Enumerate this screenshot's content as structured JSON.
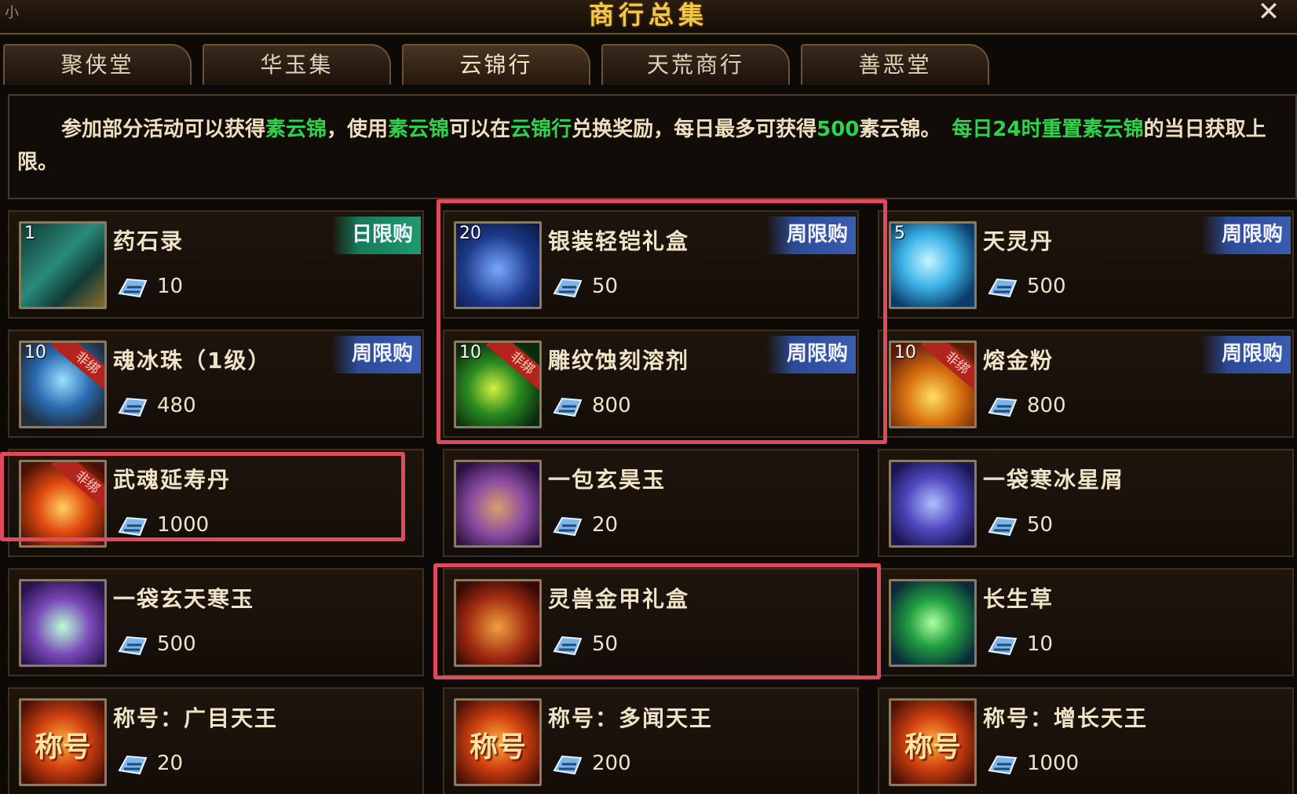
{
  "window": {
    "title": "商行总集",
    "corner_text": "小",
    "close_label": "✕"
  },
  "tabs": [
    {
      "label": "聚侠堂",
      "active": false
    },
    {
      "label": "华玉集",
      "active": false
    },
    {
      "label": "云锦行",
      "active": true
    },
    {
      "label": "天荒商行",
      "active": false
    },
    {
      "label": "善恶堂",
      "active": false
    }
  ],
  "description": {
    "p1": "参加部分活动可以获得",
    "g1": "素云锦",
    "p2": "，使用",
    "g2": "素云锦",
    "p3": "可以在",
    "g3": "云锦行",
    "p4": "兑换奖励，每日最多可获得",
    "g4": "500",
    "p5": "素云锦。",
    "g5": "每日24时重置素云锦",
    "p6": "的当日获取上限。"
  },
  "currency_icon": "cloud-brocade-icon",
  "items": [
    {
      "name": "药石录",
      "price": "10",
      "stack": "1",
      "badge": "日限购",
      "badge_color": "#1f9a6e",
      "ribbon": "",
      "icon": "scroll-icon"
    },
    {
      "name": "银装轻铠礼盒",
      "price": "50",
      "stack": "20",
      "badge": "周限购",
      "badge_color": "#3a5db0",
      "ribbon": "",
      "icon": "silver-chest-icon"
    },
    {
      "name": "天灵丹",
      "price": "500",
      "stack": "5",
      "badge": "周限购",
      "badge_color": "#3a5db0",
      "ribbon": "",
      "icon": "spirit-orb-icon"
    },
    {
      "name": "魂冰珠（1级）",
      "price": "480",
      "stack": "10",
      "badge": "周限购",
      "badge_color": "#3a5db0",
      "ribbon": "非绑",
      "icon": "ice-pearl-icon"
    },
    {
      "name": "雕纹蚀刻溶剂",
      "price": "800",
      "stack": "10",
      "badge": "周限购",
      "badge_color": "#3a5db0",
      "ribbon": "非绑",
      "icon": "green-solvent-icon"
    },
    {
      "name": "熔金粉",
      "price": "800",
      "stack": "10",
      "badge": "周限购",
      "badge_color": "#3a5db0",
      "ribbon": "非绑",
      "icon": "gold-powder-icon"
    },
    {
      "name": "武魂延寿丹",
      "price": "1000",
      "stack": "",
      "badge": "",
      "badge_color": "",
      "ribbon": "非绑",
      "icon": "fire-pill-icon"
    },
    {
      "name": "一包玄昊玉",
      "price": "20",
      "stack": "",
      "badge": "",
      "badge_color": "",
      "ribbon": "",
      "icon": "jade-pouch-icon"
    },
    {
      "name": "一袋寒冰星屑",
      "price": "50",
      "stack": "",
      "badge": "",
      "badge_color": "",
      "ribbon": "",
      "icon": "star-dust-bag-icon"
    },
    {
      "name": "一袋玄天寒玉",
      "price": "500",
      "stack": "",
      "badge": "",
      "badge_color": "",
      "ribbon": "",
      "icon": "cold-jade-bag-icon"
    },
    {
      "name": "灵兽金甲礼盒",
      "price": "50",
      "stack": "",
      "badge": "",
      "badge_color": "",
      "ribbon": "",
      "icon": "red-chest-icon"
    },
    {
      "name": "长生草",
      "price": "10",
      "stack": "",
      "badge": "",
      "badge_color": "",
      "ribbon": "",
      "icon": "herb-icon"
    },
    {
      "name": "称号：广目天王",
      "price": "20",
      "stack": "",
      "badge": "",
      "badge_color": "",
      "ribbon": "",
      "icon": "title-scroll-icon",
      "icon_text": "称号"
    },
    {
      "name": "称号：多闻天王",
      "price": "200",
      "stack": "",
      "badge": "",
      "badge_color": "",
      "ribbon": "",
      "icon": "title-scroll-icon",
      "icon_text": "称号"
    },
    {
      "name": "称号：增长天王",
      "price": "1000",
      "stack": "",
      "badge": "",
      "badge_color": "",
      "ribbon": "",
      "icon": "title-scroll-icon",
      "icon_text": "称号"
    }
  ],
  "colors": {
    "accent_gold": "#f2c84b",
    "highlight_green": "#2fd24a",
    "frame_red": "#e04a5a"
  }
}
